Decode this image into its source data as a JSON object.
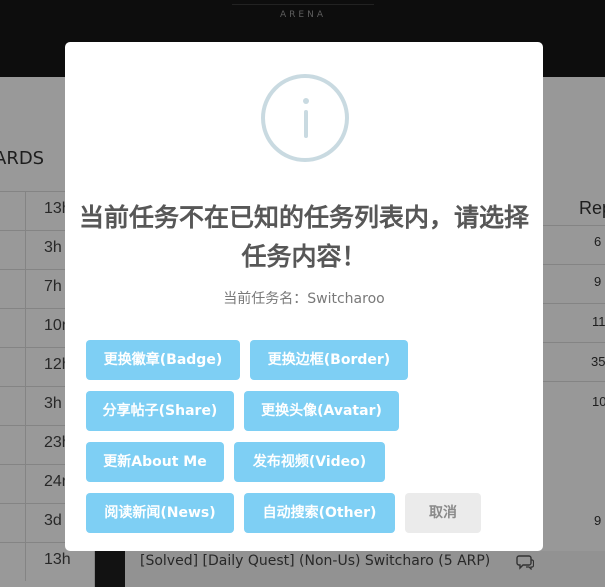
{
  "header": {
    "brand_text": "ARENA"
  },
  "background": {
    "section_label": "ARDS",
    "times": [
      "13h",
      "3h",
      "7h",
      "10m",
      "12h",
      "3h",
      "23h",
      "24m",
      "3d",
      "13h"
    ],
    "rep_header": "Rep",
    "rep_values": [
      "6",
      "9",
      "11",
      "35",
      "10",
      "9"
    ],
    "topic_title": "[Solved] [Daily Quest] (Non-Us) Switcharo (5 ARP)"
  },
  "dialog": {
    "title": "当前任务不在已知的任务列表内，请选择任务内容！",
    "subtitle": "当前任务名：Switcharoo",
    "buttons": [
      {
        "label": "更换徽章(Badge)"
      },
      {
        "label": "更换边框(Border)"
      },
      {
        "label": "分享帖子(Share)"
      },
      {
        "label": "更换头像(Avatar)"
      },
      {
        "label": "更新About Me"
      },
      {
        "label": "发布视频(Video)"
      },
      {
        "label": "阅读新闻(News)"
      },
      {
        "label": "自动搜索(Other)"
      }
    ],
    "cancel_label": "取消",
    "colors": {
      "button": "#7ecff4",
      "cancel_button": "#ebebeb",
      "icon": "#c9dae1"
    }
  }
}
